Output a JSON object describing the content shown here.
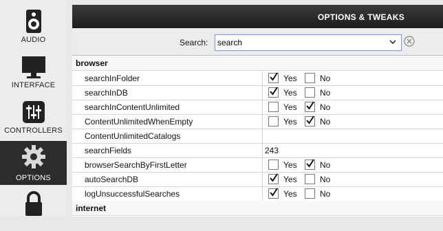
{
  "sidebar": {
    "items": [
      {
        "label": "AUDIO",
        "icon": "speaker-icon"
      },
      {
        "label": "INTERFACE",
        "icon": "monitor-icon"
      },
      {
        "label": "CONTROLLERS",
        "icon": "sliders-icon"
      },
      {
        "label": "OPTIONS",
        "icon": "gear-icon",
        "active": true
      },
      {
        "label": "",
        "icon": "lock-icon"
      }
    ]
  },
  "header": {
    "title": "OPTIONS & TWEAKS"
  },
  "search": {
    "label": "Search:",
    "value": "search"
  },
  "choices": {
    "yes": "Yes",
    "no": "No"
  },
  "table": {
    "groups": [
      {
        "name": "browser"
      },
      {
        "name": "internet"
      }
    ],
    "rows": [
      {
        "name": "searchInFolder",
        "type": "bool",
        "yes": true,
        "no": false
      },
      {
        "name": "searchInDB",
        "type": "bool",
        "yes": true,
        "no": false
      },
      {
        "name": "searchInContentUnlimited",
        "type": "bool",
        "yes": false,
        "no": true
      },
      {
        "name": "ContentUnlimitedWhenEmpty",
        "type": "bool",
        "yes": false,
        "no": true
      },
      {
        "name": "ContentUnlimitedCatalogs",
        "type": "text",
        "value": ""
      },
      {
        "name": "searchFields",
        "type": "text",
        "value": "243"
      },
      {
        "name": "browserSearchByFirstLetter",
        "type": "bool",
        "yes": false,
        "no": true
      },
      {
        "name": "autoSearchDB",
        "type": "bool",
        "yes": true,
        "no": false
      },
      {
        "name": "logUnsuccessfulSearches",
        "type": "bool",
        "yes": true,
        "no": false
      }
    ]
  },
  "colors": {
    "active_bg": "#2c2c2c",
    "header_bg": "#1e1e1e",
    "focus": "#8aa0c8"
  }
}
